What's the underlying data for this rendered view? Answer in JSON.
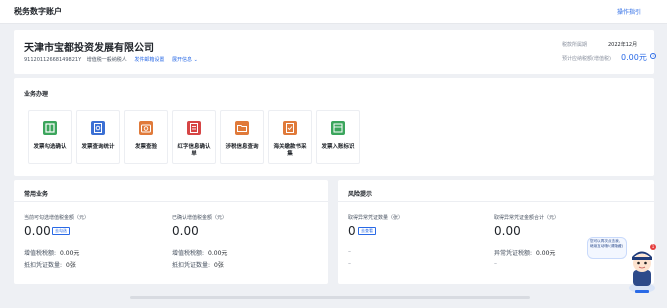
{
  "header": {
    "title": "税务数字账户",
    "guide_link": "操作指引"
  },
  "company": {
    "name": "天津市宝都投资发展有限公司",
    "tax_id": "91120112668149821Y",
    "taxpayer_type": "增值税一般纳税人",
    "mailbox_link": "发件邮箱设置",
    "expand_link": "展开信息",
    "period_label": "税款所属期",
    "period_value": "2022年12月",
    "tax_label": "预计应纳税额(增值税)",
    "tax_value": "0.00元"
  },
  "business": {
    "title": "业务办理",
    "tiles": [
      {
        "label": "发票勾选确认",
        "icon": "checklist-icon",
        "color": "#3ba55c"
      },
      {
        "label": "发票查询统计",
        "icon": "search-document-icon",
        "color": "#3b6fd4"
      },
      {
        "label": "发票查验",
        "icon": "camera-check-icon",
        "color": "#e07a3a"
      },
      {
        "label": "红字信息确认单",
        "icon": "red-invoice-icon",
        "color": "#d64545"
      },
      {
        "label": "涉税信息查询",
        "icon": "folder-search-icon",
        "color": "#e07a3a"
      },
      {
        "label": "海关缴款书采集",
        "icon": "customs-form-icon",
        "color": "#e07a3a"
      },
      {
        "label": "发票入账标识",
        "icon": "ledger-icon",
        "color": "#3ba55c"
      }
    ]
  },
  "common": {
    "title": "常用业务",
    "left_label": "当前可勾选增值税金额（元）",
    "left_tag": "去勾选",
    "left_value": "0.00",
    "right_label": "已确认增值税金额（元）",
    "right_value": "0.00",
    "left_stats": [
      {
        "k": "增值税税额:",
        "v": "0.00元"
      },
      {
        "k": "抵扣凭证数量:",
        "v": "0张"
      }
    ],
    "right_stats": [
      {
        "k": "增值税税额:",
        "v": "0.00元"
      },
      {
        "k": "抵扣凭证数量:",
        "v": "0张"
      }
    ]
  },
  "risk": {
    "title": "风险提示",
    "left_label": "取得异常凭证数量（张）",
    "left_tag": "去查看",
    "left_value": "0",
    "right_label": "取得异常凭证金额合计（元）",
    "right_value": "0.00",
    "right_stat": {
      "k": "异常凭证税额:",
      "v": "0.00元"
    },
    "dash": "–"
  },
  "assistant": {
    "bubble_text": "您可以再次点击我，继续互动哦!(请隐藏)",
    "badge": "1"
  }
}
